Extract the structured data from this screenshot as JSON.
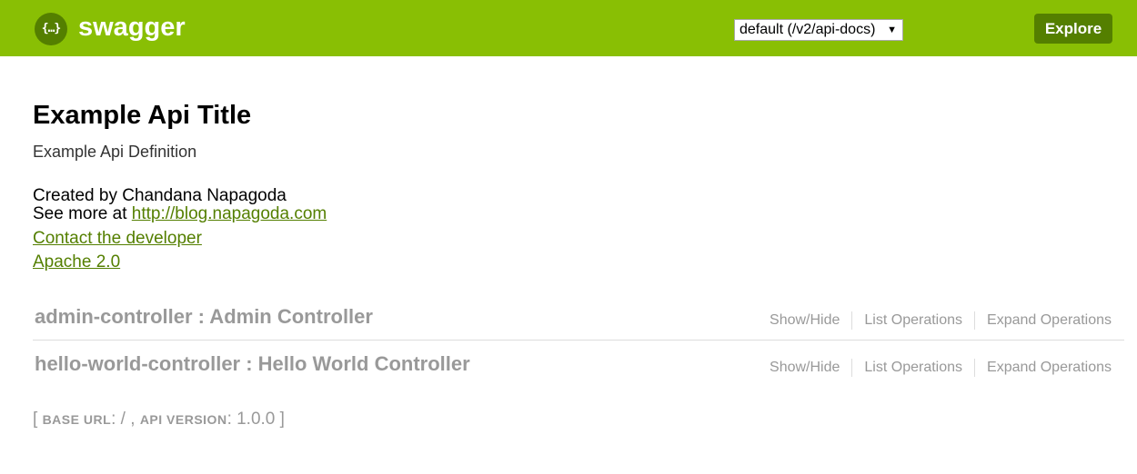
{
  "header": {
    "logo_glyph": "{…}",
    "logo_text": "swagger",
    "api_select": {
      "selected": "default (/v2/api-docs)",
      "caret": "▼"
    },
    "explore_label": "Explore",
    "color_primary": "#89bf04",
    "color_dark": "#547f00"
  },
  "info": {
    "title": "Example Api Title",
    "description": "Example Api Definition",
    "created_by": "Created by Chandana Napagoda",
    "see_more_prefix": "See more at ",
    "see_more_link": "http://blog.napagoda.com",
    "contact_label": "Contact the developer",
    "license_label": "Apache 2.0"
  },
  "resources": [
    {
      "name": "admin-controller : Admin Controller",
      "show_hide": "Show/Hide",
      "list_operations": "List Operations",
      "expand_operations": "Expand Operations"
    },
    {
      "name": "hello-world-controller : Hello World Controller",
      "show_hide": "Show/Hide",
      "list_operations": "List Operations",
      "expand_operations": "Expand Operations"
    }
  ],
  "footer": {
    "open_bracket": "[ ",
    "base_url_label": "BASE URL",
    "base_url_value": ": / , ",
    "api_version_label": "API VERSION",
    "api_version_value": ": 1.0.0 ",
    "close_bracket": "]"
  }
}
